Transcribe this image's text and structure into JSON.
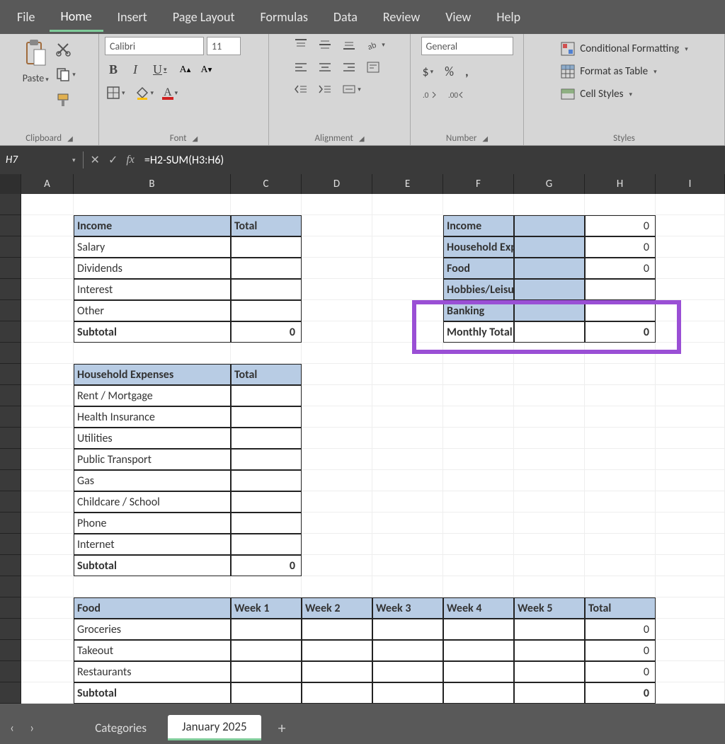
{
  "menu": {
    "file": "File",
    "home": "Home",
    "insert": "Insert",
    "pageLayout": "Page Layout",
    "formulas": "Formulas",
    "data": "Data",
    "review": "Review",
    "view": "View",
    "help": "Help"
  },
  "ribbon": {
    "clipboard": {
      "paste": "Paste",
      "label": "Clipboard"
    },
    "font": {
      "name": "Calibri",
      "size": "11",
      "label": "Font"
    },
    "alignment": {
      "label": "Alignment"
    },
    "number": {
      "format": "General",
      "label": "Number"
    },
    "styles": {
      "cond": "Conditional Formatting",
      "table": "Format as Table",
      "cell": "Cell Styles",
      "label": "Styles"
    }
  },
  "formulaBar": {
    "nameBox": "H7",
    "formula": "=H2-SUM(H3:H6)"
  },
  "columns": [
    "A",
    "B",
    "C",
    "D",
    "E",
    "F",
    "G",
    "H",
    "I"
  ],
  "tables": {
    "income": {
      "header": [
        "Income",
        "Total"
      ],
      "rows": [
        "Salary",
        "Dividends",
        "Interest",
        "Other"
      ],
      "subtotal": "Subtotal",
      "subtotalVal": "0"
    },
    "summary": {
      "rows": [
        {
          "label": "Income",
          "val": "0"
        },
        {
          "label": "Household Expenses",
          "val": "0"
        },
        {
          "label": "Food",
          "val": "0"
        },
        {
          "label": "Hobbies/Leisure",
          "val": ""
        },
        {
          "label": "Banking",
          "val": ""
        },
        {
          "label": "Monthly Total",
          "val": "0"
        }
      ]
    },
    "household": {
      "header": [
        "Household Expenses",
        "Total"
      ],
      "rows": [
        "Rent / Mortgage",
        "Health Insurance",
        "Utilities",
        "Public Transport",
        "Gas",
        "Childcare / School",
        "Phone",
        "Internet"
      ],
      "subtotal": "Subtotal",
      "subtotalVal": "0"
    },
    "food": {
      "header": [
        "Food",
        "Week 1",
        "Week 2",
        "Week 3",
        "Week 4",
        "Week 5",
        "Total"
      ],
      "rows": [
        "Groceries",
        "Takeout",
        "Restaurants"
      ],
      "subtotal": "Subtotal",
      "totalVal": "0"
    }
  },
  "sheetTabs": {
    "categories": "Categories",
    "january": "January 2025"
  }
}
